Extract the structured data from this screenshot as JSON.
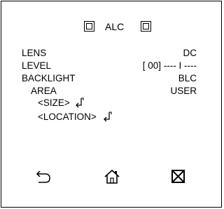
{
  "menu": {
    "title": "ALC",
    "prev_icon": "square-box-icon",
    "next_icon": "square-box-icon"
  },
  "settings": {
    "lens": {
      "label": "LENS",
      "value": "DC"
    },
    "level": {
      "label": "LEVEL",
      "value": "[ 00] ---- I ----"
    },
    "backlight": {
      "label": "BACKLIGHT",
      "value": "BLC"
    },
    "area": {
      "label": "AREA",
      "value": "USER"
    },
    "size": {
      "label": "<SIZE>",
      "icon": "enter-icon"
    },
    "location": {
      "label": "<LOCATION>",
      "icon": "enter-icon"
    }
  },
  "bottom_bar": {
    "back_icon": "return-icon",
    "home_icon": "home-icon",
    "exit_icon": "close-box-icon"
  }
}
